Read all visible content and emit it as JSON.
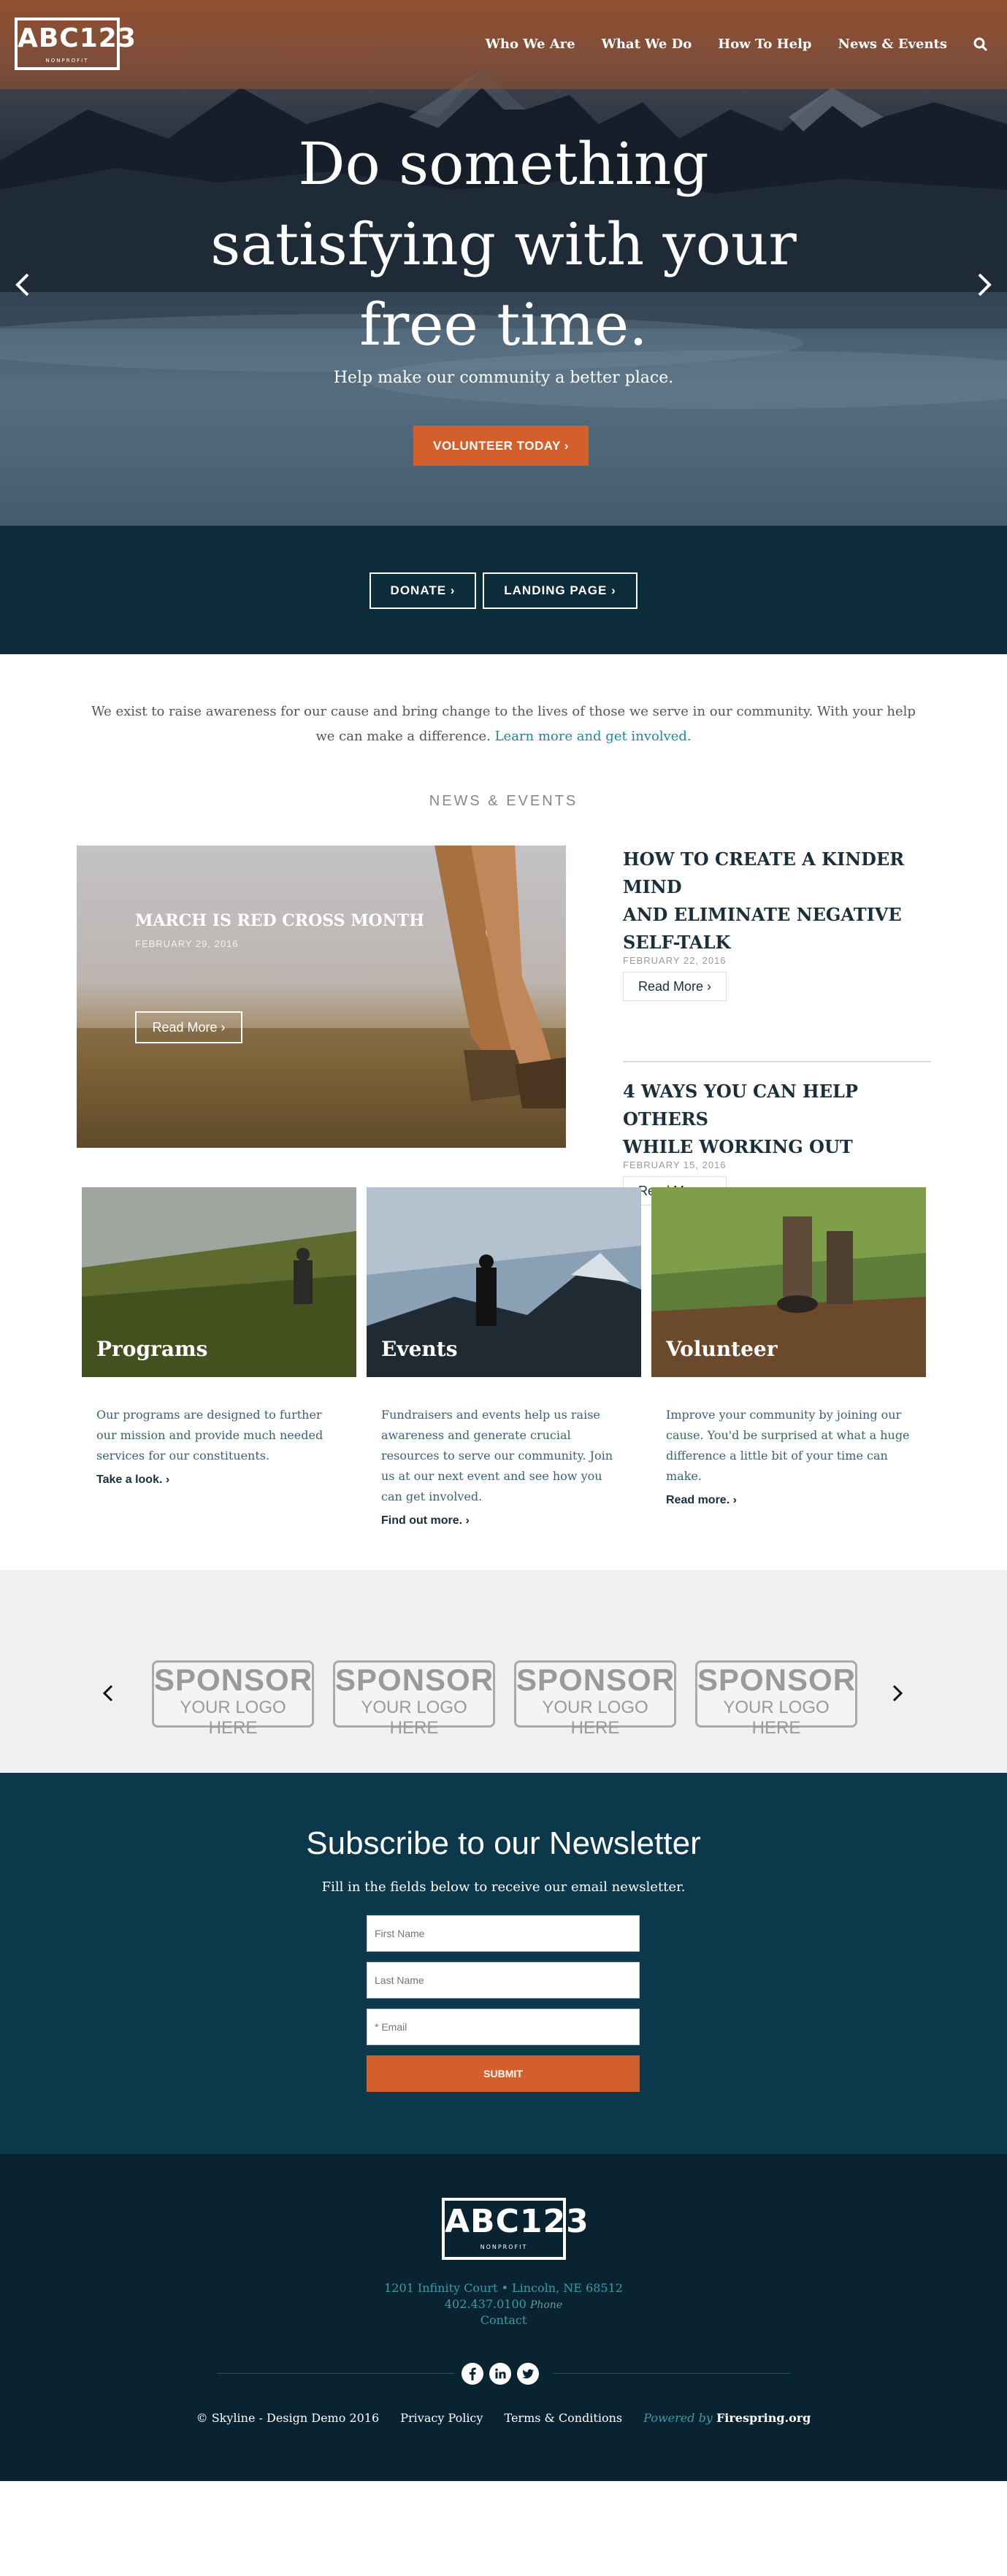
{
  "brand": {
    "logo_mark": "ABC123",
    "logo_sub": "NONPROFIT"
  },
  "nav": {
    "items": [
      "Who We Are",
      "What We Do",
      "How To Help",
      "News & Events"
    ]
  },
  "hero": {
    "title_line1": "Do something",
    "title_line2": "satisfying with your",
    "title_line3": "free time.",
    "subtitle": "Help make our community a better place.",
    "cta_label": "VOLUNTEER TODAY ›"
  },
  "cta_band": {
    "donate_label": "DONATE ›",
    "landing_label": "LANDING PAGE ›"
  },
  "mission": {
    "text": "We exist to raise awareness for our cause and bring change to the lives of those we serve in our community. With your help we can make a difference.",
    "link": "Learn more and get involved."
  },
  "news": {
    "heading": "NEWS & EVENTS",
    "featured": {
      "title": "MARCH IS RED CROSS MONTH",
      "date": "FEBRUARY 29, 2016",
      "button": "Read More ›"
    },
    "items": [
      {
        "title_line1": "HOW TO CREATE A KINDER MIND",
        "title_line2": "AND ELIMINATE NEGATIVE",
        "title_line3": "SELF-TALK",
        "date": "FEBRUARY 22, 2016",
        "button": "Read More ›"
      },
      {
        "title_line1": "4 WAYS YOU CAN HELP OTHERS",
        "title_line2": "WHILE WORKING OUT",
        "date": "FEBRUARY 15, 2016",
        "button": "Read More ›"
      }
    ]
  },
  "cards": [
    {
      "label": "Programs",
      "text": "Our programs are designed to further our mission and provide much needed services for our constituents.",
      "link": "Take a look.  ›"
    },
    {
      "label": "Events",
      "text": "Fundraisers and events help us raise awareness and generate crucial resources to serve our community. Join us at our next event and see how you can get involved.",
      "link": "Find out more.  ›"
    },
    {
      "label": "Volunteer",
      "text": "Improve your community by joining our cause. You'd be surprised at what a huge difference a little bit of your time can make.",
      "link": "Read more.  ›"
    }
  ],
  "sponsors": {
    "big": "SPONSOR",
    "small": "YOUR LOGO HERE"
  },
  "newsletter": {
    "title": "Subscribe to our Newsletter",
    "subtitle": "Fill in the fields below to receive our email newsletter.",
    "first_name_placeholder": "First Name",
    "last_name_placeholder": "Last Name",
    "email_placeholder": "* Email",
    "submit_label": "SUBMIT"
  },
  "footer": {
    "address": "1201 Infinity Court • Lincoln, NE 68512",
    "phone": "402.437.0100",
    "phone_label": "Phone",
    "contact": "Contact",
    "copyright": "© Skyline - Design Demo 2016",
    "privacy": "Privacy Policy",
    "terms": "Terms & Conditions",
    "powered_by": "Powered by",
    "powered_brand": "Firespring.org"
  },
  "colors": {
    "accent": "#d35f2c",
    "dark_teal": "#0c2c3a",
    "newsletter_bg": "#0c384c",
    "footer_bg": "#092330",
    "link": "#1c8a94"
  }
}
